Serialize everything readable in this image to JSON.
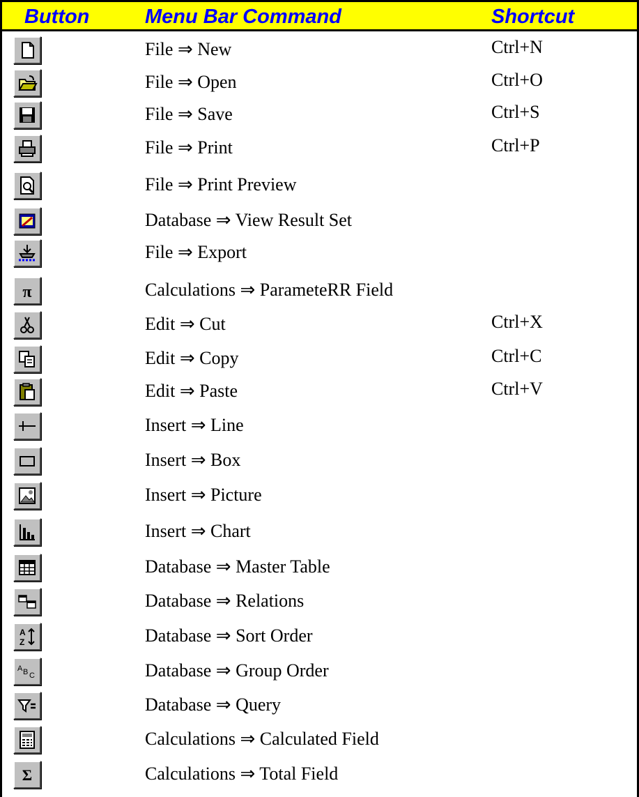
{
  "table": {
    "headers": {
      "button": "Button",
      "command": "Menu Bar Command",
      "shortcut": "Shortcut"
    },
    "rows": [
      {
        "icon": "new-document-icon",
        "command": "File ⇒ New",
        "shortcut": "Ctrl+N"
      },
      {
        "icon": "open-folder-icon",
        "command": "File ⇒ Open",
        "shortcut": "Ctrl+O"
      },
      {
        "icon": "save-disk-icon",
        "command": "File ⇒ Save",
        "shortcut": "Ctrl+S"
      },
      {
        "icon": "printer-icon",
        "command": "File ⇒ Print",
        "shortcut": "Ctrl+P"
      },
      {
        "icon": "print-preview-icon",
        "command": "File ⇒ Print Preview",
        "shortcut": ""
      },
      {
        "icon": "view-result-set-icon",
        "command": "Database ⇒ View Result Set",
        "shortcut": ""
      },
      {
        "icon": "export-icon",
        "command": "File ⇒ Export",
        "shortcut": ""
      },
      {
        "icon": "pi-parameter-icon",
        "command": "Calculations ⇒ ParameteRR Field",
        "shortcut": ""
      },
      {
        "icon": "scissors-icon",
        "command": "Edit ⇒ Cut",
        "shortcut": "Ctrl+X"
      },
      {
        "icon": "copy-icon",
        "command": "Edit ⇒ Copy",
        "shortcut": "Ctrl+C"
      },
      {
        "icon": "paste-clipboard-icon",
        "command": "Edit ⇒ Paste",
        "shortcut": "Ctrl+V"
      },
      {
        "icon": "line-tool-icon",
        "command": "Insert ⇒ Line",
        "shortcut": ""
      },
      {
        "icon": "box-tool-icon",
        "command": "Insert ⇒ Box",
        "shortcut": ""
      },
      {
        "icon": "picture-icon",
        "command": "Insert ⇒ Picture",
        "shortcut": ""
      },
      {
        "icon": "bar-chart-icon",
        "command": "Insert ⇒ Chart",
        "shortcut": ""
      },
      {
        "icon": "master-table-icon",
        "command": "Database ⇒ Master Table",
        "shortcut": ""
      },
      {
        "icon": "relations-icon",
        "command": "Database ⇒ Relations",
        "shortcut": ""
      },
      {
        "icon": "sort-az-icon",
        "command": "Database ⇒ Sort Order",
        "shortcut": ""
      },
      {
        "icon": "group-order-abc-icon",
        "command": "Database ⇒ Group Order",
        "shortcut": ""
      },
      {
        "icon": "query-filter-icon",
        "command": "Database ⇒ Query",
        "shortcut": ""
      },
      {
        "icon": "calculator-icon",
        "command": "Calculations ⇒ Calculated Field",
        "shortcut": ""
      },
      {
        "icon": "sigma-total-icon",
        "command": "Calculations ⇒ Total Field",
        "shortcut": ""
      }
    ]
  }
}
